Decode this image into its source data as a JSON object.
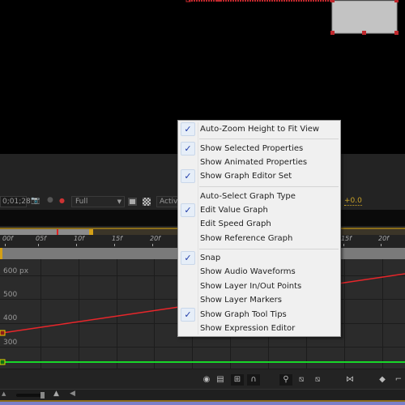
{
  "toolbar": {
    "timecode": "0;01;28",
    "resolution": "Full",
    "view": "Active Camera",
    "exposure": "+0.0"
  },
  "ruler": {
    "ticks": [
      "00f",
      "05f",
      "10f",
      "15f",
      "20f",
      "15f",
      "20f"
    ]
  },
  "graph": {
    "y_labels": [
      "600 px",
      "500",
      "400",
      "300"
    ],
    "curves": [
      {
        "property": "position-x",
        "color": "#e8262b"
      },
      {
        "property": "position-y",
        "color": "#18d629"
      }
    ]
  },
  "menu": {
    "items": [
      {
        "label": "Auto-Zoom Height to Fit View",
        "checked": true
      },
      {
        "label": "Show Selected Properties",
        "checked": true
      },
      {
        "label": "Show Animated Properties",
        "checked": false
      },
      {
        "label": "Show Graph Editor Set",
        "checked": true
      },
      {
        "label": "Auto-Select Graph Type",
        "checked": false
      },
      {
        "label": "Edit Value Graph",
        "checked": true
      },
      {
        "label": "Edit Speed Graph",
        "checked": false
      },
      {
        "label": "Show Reference Graph",
        "checked": false
      },
      {
        "label": "Snap",
        "checked": true
      },
      {
        "label": "Show Audio Waveforms",
        "checked": false
      },
      {
        "label": "Show Layer In/Out Points",
        "checked": false
      },
      {
        "label": "Show Layer Markers",
        "checked": false
      },
      {
        "label": "Show Graph Tool Tips",
        "checked": true
      },
      {
        "label": "Show Expression Editor",
        "checked": false
      }
    ],
    "check_glyph": "✓"
  },
  "icons": [
    "eye-icon",
    "graph-options-icon",
    "transform-box-icon",
    "snap-magnet-icon",
    "fit-selection-icon",
    "fit-all-icon",
    "fit-graph-icon",
    "separate-dimensions-icon",
    "keyframe-icon",
    "convert-keyframe-icon"
  ]
}
